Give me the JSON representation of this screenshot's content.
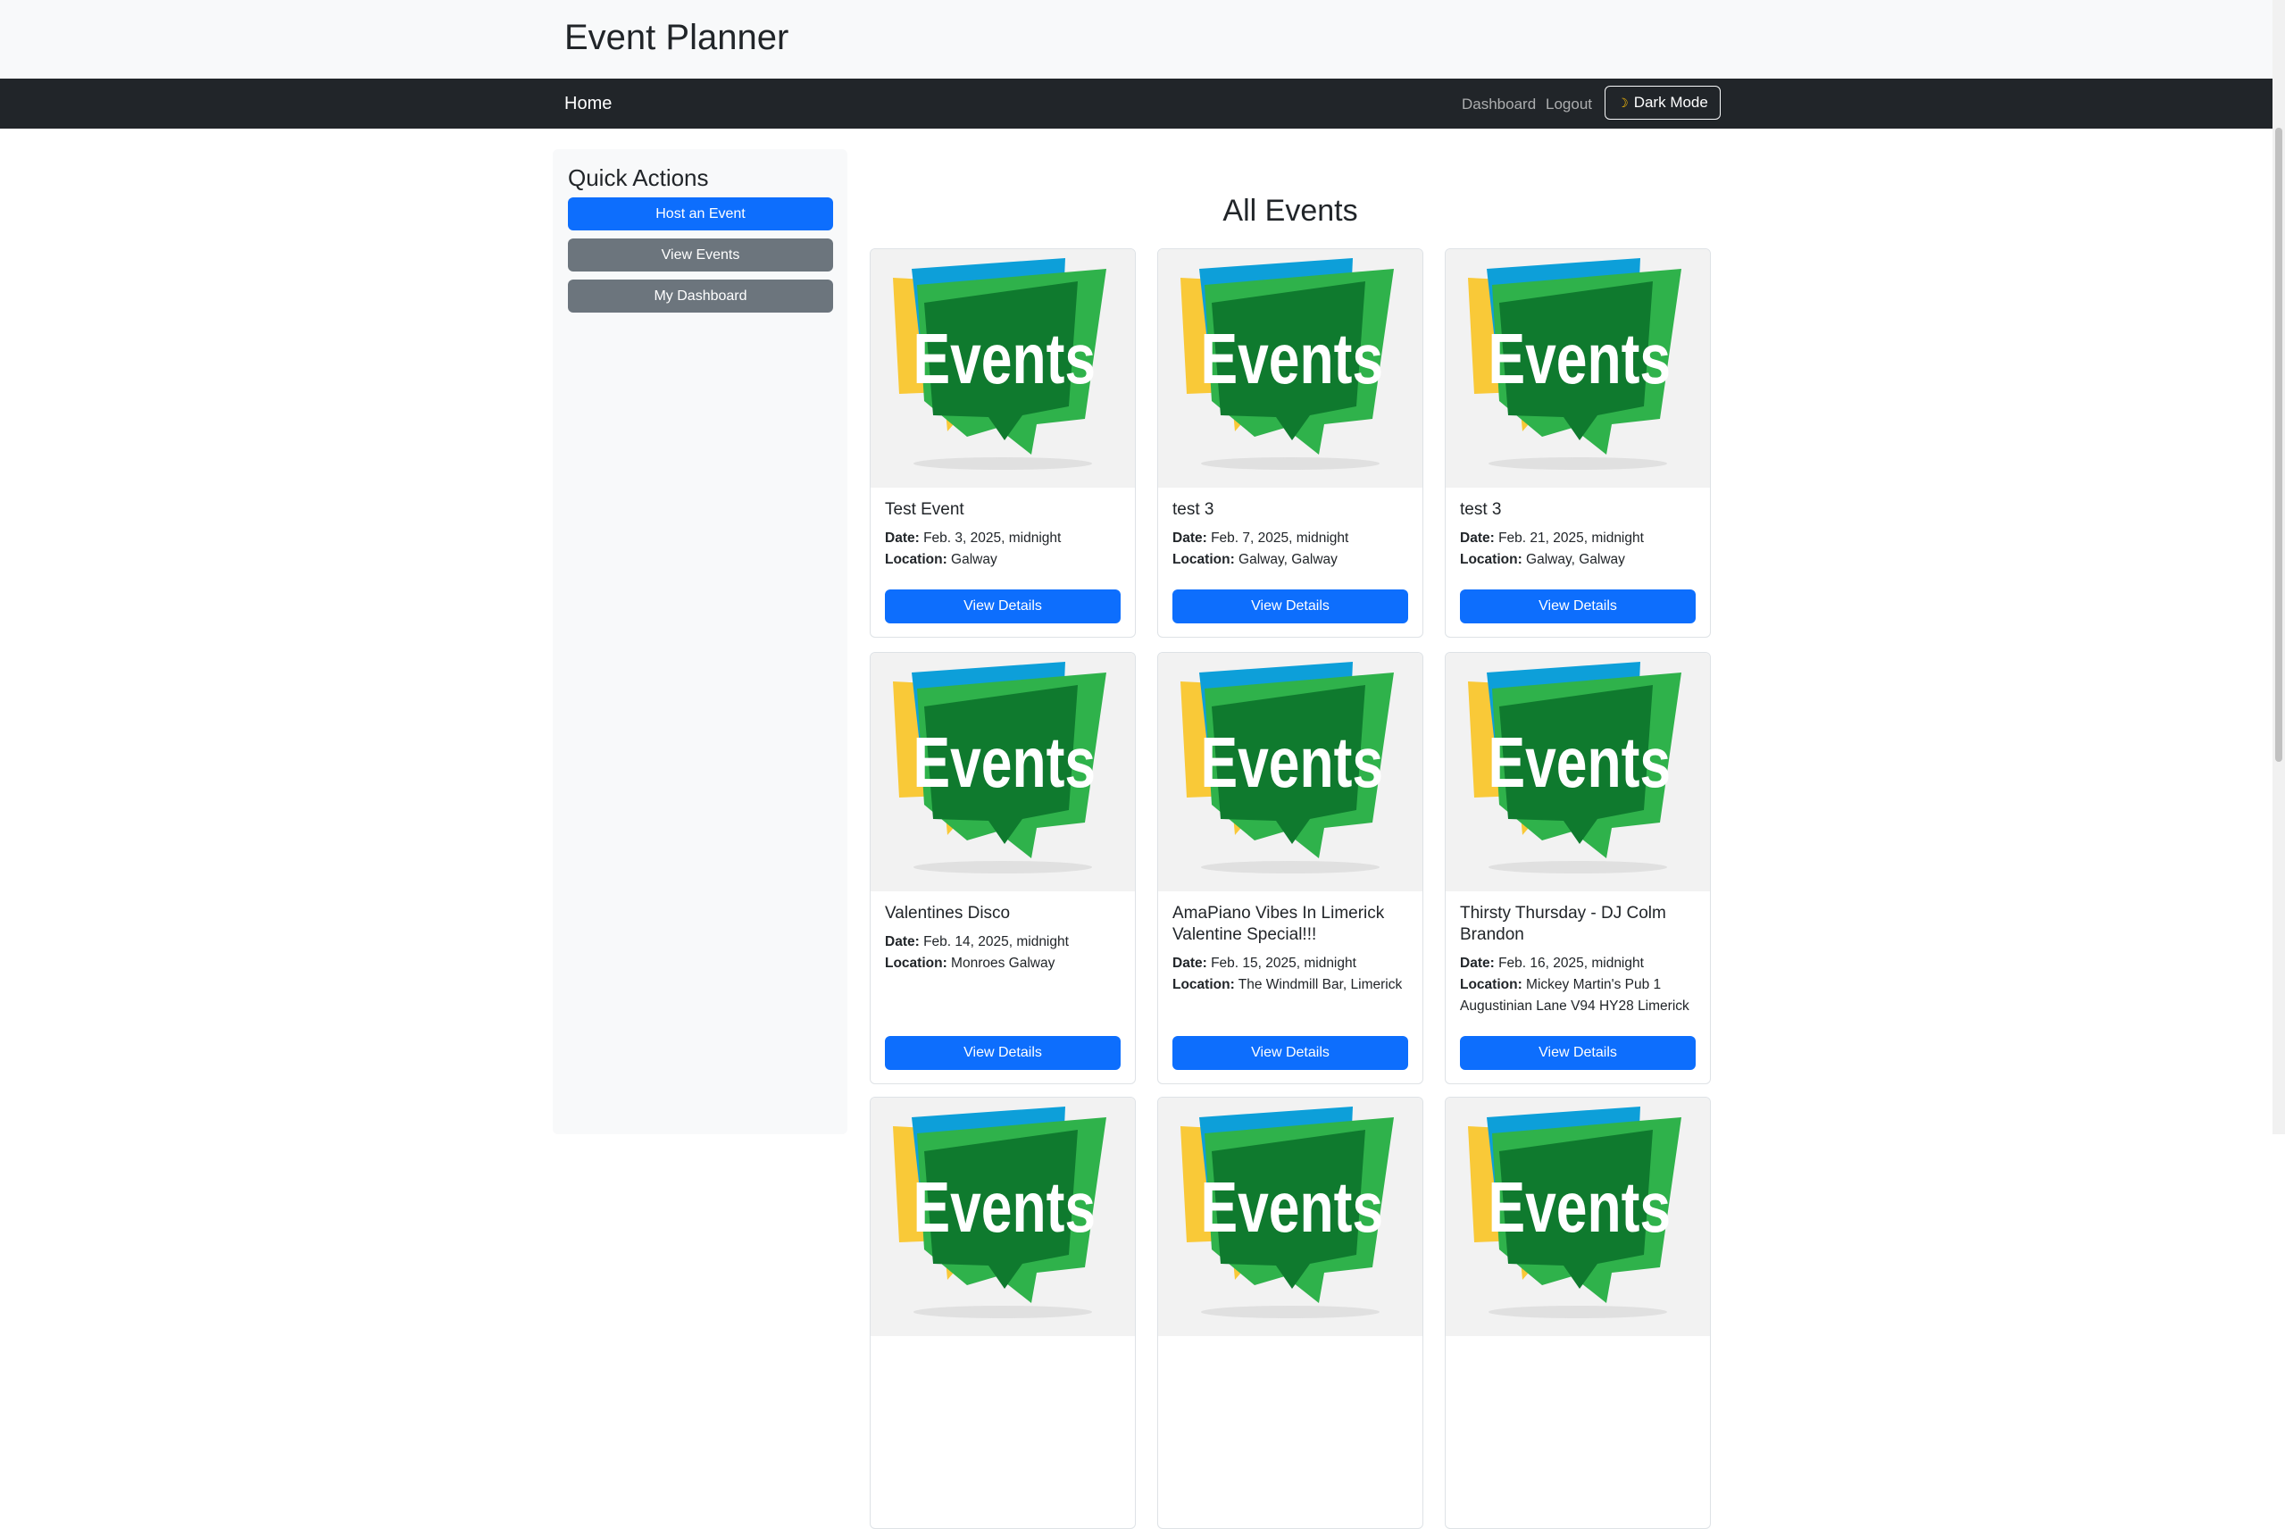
{
  "app": {
    "title": "Event Planner"
  },
  "nav": {
    "home": "Home",
    "links": [
      "Dashboard",
      "Logout"
    ],
    "dark_mode": {
      "icon": "moon-icon",
      "label": "Dark Mode"
    }
  },
  "sidebar": {
    "title": "Quick Actions",
    "buttons": [
      "Host an Event",
      "View Events",
      "My Dashboard"
    ]
  },
  "main": {
    "heading": "All Events",
    "event_image_text": "Events",
    "date_label": "Date:",
    "location_label": "Location:",
    "button_label": "View Details",
    "events": [
      {
        "title": "Test Event",
        "date": "Feb. 3, 2025, midnight",
        "location": "Galway"
      },
      {
        "title": "test 3",
        "date": "Feb. 7, 2025, midnight",
        "location": "Galway, Galway"
      },
      {
        "title": "test 3",
        "date": "Feb. 21, 2025, midnight",
        "location": "Galway, Galway"
      },
      {
        "title": "Valentines Disco",
        "date": "Feb. 14, 2025, midnight",
        "location": "Monroes Galway"
      },
      {
        "title": "AmaPiano Vibes In Limerick Valentine Special!!!",
        "date": "Feb. 15, 2025, midnight",
        "location": "The Windmill Bar, Limerick"
      },
      {
        "title": "Thirsty Thursday - DJ Colm Brandon",
        "date": "Feb. 16, 2025, midnight",
        "location": "Mickey Martin's Pub 1 Augustinian Lane V94 HY28 Limerick"
      }
    ]
  },
  "colors": {
    "primary": "#0d6efd",
    "secondary": "#6c757d",
    "navbar": "#212529",
    "sidebar_bg": "#f8f9fa",
    "logo_blue": "#0d9fd9",
    "logo_yellow": "#f9c938",
    "logo_green": "#2fb24b",
    "logo_dark_green": "#0f7a2e"
  }
}
